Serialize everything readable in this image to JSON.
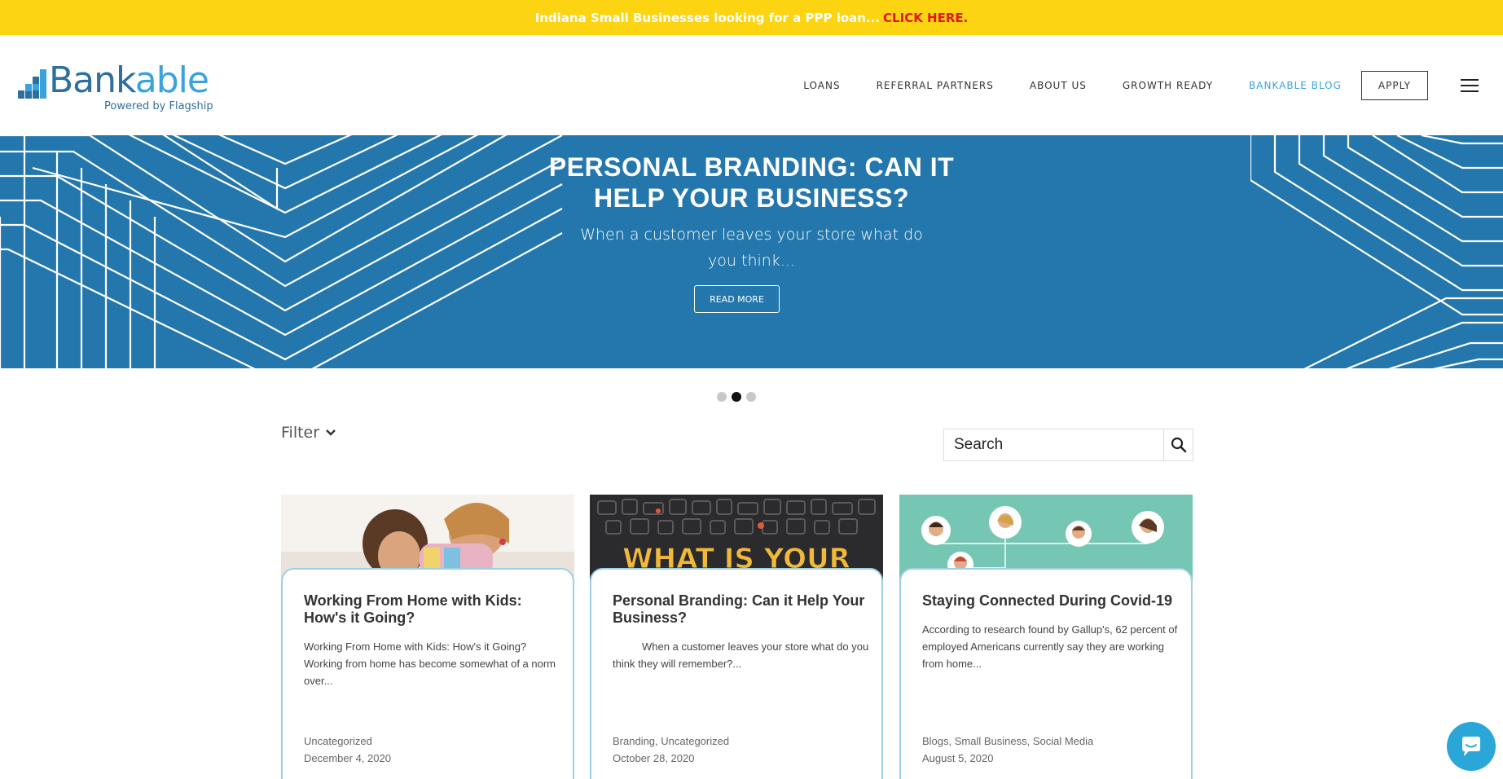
{
  "banner": {
    "text": "Indiana Small Businesses looking for a PPP loan...",
    "cta": "CLICK HERE."
  },
  "logo": {
    "name_part1": "Bank",
    "name_part2": "able",
    "tagline": "Powered by Flagship"
  },
  "nav": {
    "items": [
      "LOANS",
      "REFERRAL PARTNERS",
      "ABOUT US",
      "GROWTH READY",
      "BANKABLE BLOG"
    ],
    "active_index": 4,
    "apply_label": "APPLY"
  },
  "hero": {
    "title_line1": "PERSONAL BRANDING: CAN IT",
    "title_line2": "HELP YOUR BUSINESS?",
    "subtitle": "When a customer leaves your store what do you think...",
    "button_label": "READ MORE"
  },
  "slider": {
    "count": 3,
    "active_index": 1
  },
  "filter": {
    "label": "Filter"
  },
  "search": {
    "placeholder": "Search"
  },
  "posts": [
    {
      "title": "Working From Home with Kids: How's it Going?",
      "excerpt": "Working From Home with Kids: How's it Going? Working from home has become somewhat of a norm over...",
      "categories": "Uncategorized",
      "date": "December 4, 2020"
    },
    {
      "title": "Personal Branding: Can it Help Your Business?",
      "excerpt": "When a customer leaves your store what do you think they will remember?...",
      "categories": "Branding, Uncategorized",
      "date": "October 28, 2020",
      "image_text": "WHAT IS YOUR"
    },
    {
      "title": "Staying Connected During Covid-19",
      "excerpt": "According to research found by Gallup's, 62 percent of employed Americans currently say they are working from home...",
      "categories": "Blogs, Small Business, Social Media",
      "date": "August 5, 2020"
    }
  ],
  "colors": {
    "banner_bg": "#fcd411",
    "banner_cta": "#e3161b",
    "hero_bg": "#2477ac",
    "brand_dark": "#2e6f9e",
    "brand_light": "#3aa3dc",
    "card_border": "#9ecfe6",
    "chat_bg": "#2aa7d8"
  },
  "icons": [
    "logo-bars-icon",
    "hamburger-icon",
    "chevron-down-icon",
    "search-icon",
    "chat-icon"
  ]
}
